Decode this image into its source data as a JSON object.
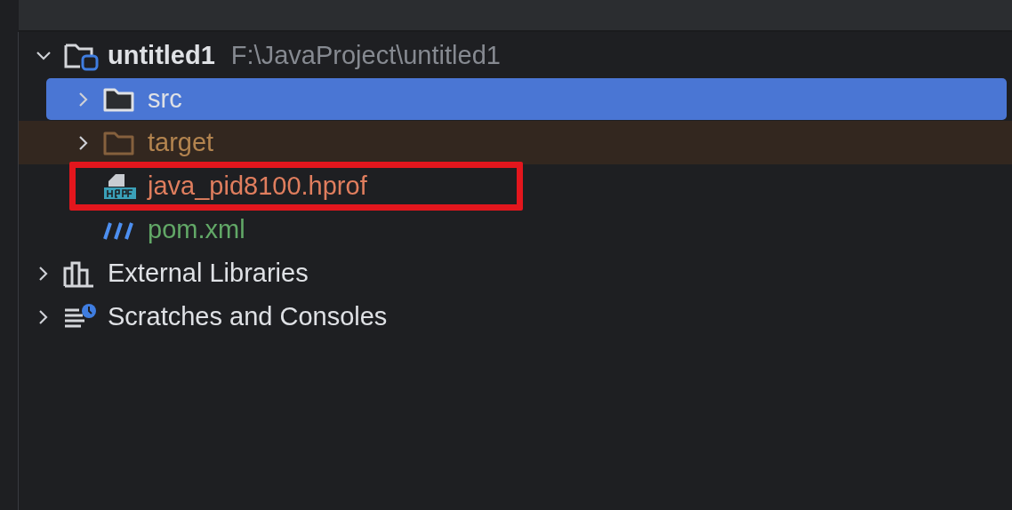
{
  "project_tree": [
    {
      "kind": "project",
      "label": "untitled1",
      "path": "F:\\JavaProject\\untitled1",
      "expanded": true,
      "selected": false,
      "highlighted": false,
      "children": [
        {
          "kind": "folder",
          "label": "src",
          "expanded": false,
          "selected": true,
          "highlighted": false
        },
        {
          "kind": "excluded_folder",
          "label": "target",
          "expanded": false,
          "selected": false,
          "highlighted": false
        },
        {
          "kind": "hprof",
          "label": "java_pid8100.hprof",
          "color": "#e07e5e",
          "selected": false,
          "highlighted": true
        },
        {
          "kind": "maven",
          "label": "pom.xml",
          "color": "#62a867",
          "selected": false,
          "highlighted": false
        }
      ]
    },
    {
      "kind": "libraries",
      "label": "External Libraries",
      "expanded": false,
      "selected": false,
      "highlighted": false
    },
    {
      "kind": "scratches",
      "label": "Scratches and Consoles",
      "expanded": false,
      "selected": false,
      "highlighted": false
    }
  ]
}
